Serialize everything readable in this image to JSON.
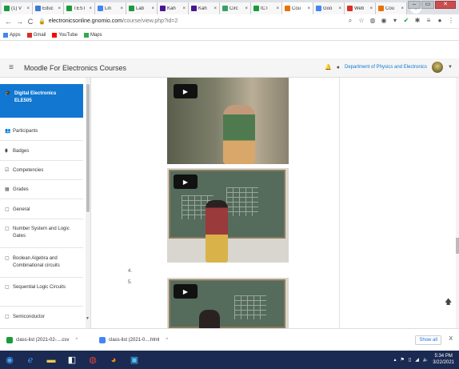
{
  "browser": {
    "tabs": [
      {
        "label": "(1) V",
        "color": "#1a9a3c"
      },
      {
        "label": "Educ",
        "color": "#3a7bd5"
      },
      {
        "label": "TEST",
        "color": "#1a9a3c"
      },
      {
        "label": "Lin",
        "color": "#4285f4"
      },
      {
        "label": "Lab",
        "color": "#1a9a3c"
      },
      {
        "label": "Kah",
        "color": "#46178f"
      },
      {
        "label": "Kah",
        "color": "#46178f"
      },
      {
        "label": "Circ",
        "color": "#38a169"
      },
      {
        "label": "ICT",
        "color": "#1a9a3c"
      },
      {
        "label": "Cou",
        "color": "#e8710a"
      },
      {
        "label": "Goo",
        "color": "#4285f4"
      },
      {
        "label": "Web",
        "color": "#d93025"
      },
      {
        "label": "Cou",
        "color": "#e8710a"
      }
    ],
    "new_tab": "+",
    "url_host": "electronicsonline.gnomio.com",
    "url_path": "/course/view.php?id=2",
    "bookmarks": [
      {
        "label": "Apps",
        "color": "#4285f4"
      },
      {
        "label": "Gmail",
        "color": "#d93025"
      },
      {
        "label": "YouTube",
        "color": "#ff0000"
      },
      {
        "label": "Maps",
        "color": "#34a853"
      }
    ]
  },
  "moodle": {
    "site_name": "Moodle For Electronics Courses",
    "user": "Department of Physics and Electronics",
    "course_short": "Digital Electronics",
    "course_code": "ELE505",
    "nav_items": [
      {
        "label": "Participants",
        "icon": "users-icon"
      },
      {
        "label": "Badges",
        "icon": "badge-icon"
      },
      {
        "label": "Competencies",
        "icon": "check-icon"
      },
      {
        "label": "Grades",
        "icon": "table-icon"
      },
      {
        "label": "General",
        "icon": "folder-icon"
      },
      {
        "label": "Number System and Logic Gates",
        "icon": "folder-icon"
      },
      {
        "label": "Boolean Algebra and Combinational circuits",
        "icon": "folder-icon"
      },
      {
        "label": "Sequential Logic Circuits",
        "icon": "folder-icon"
      },
      {
        "label": "Semiconductor",
        "icon": "folder-icon"
      }
    ],
    "numbers": [
      "4.",
      "5."
    ]
  },
  "downloads": {
    "items": [
      {
        "label": "class-list (2021-02-....csv",
        "color": "#1a9a3c"
      },
      {
        "label": "class-list (2021-0....html",
        "color": "#4285f4"
      }
    ],
    "show_all": "Show all",
    "close": "X"
  },
  "taskbar": {
    "time": "5:34 PM",
    "date": "3/22/2021"
  }
}
